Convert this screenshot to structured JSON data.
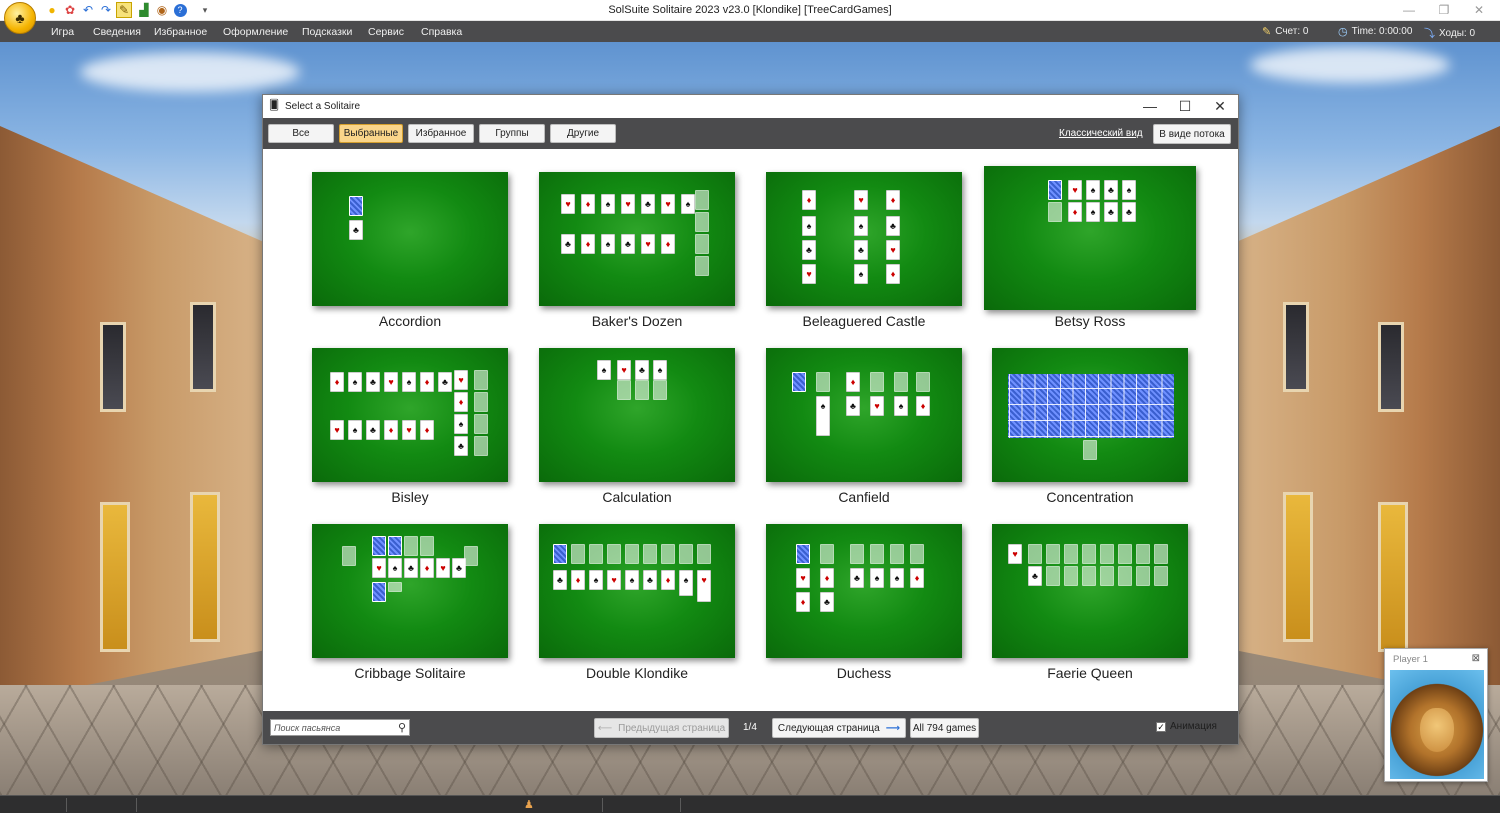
{
  "app": {
    "title": "SolSuite Solitaire 2023 v23.0  [Klondike]  [TreeCardGames]"
  },
  "menu": {
    "items": [
      "Игра",
      "Сведения",
      "Избранное",
      "Оформление",
      "Подсказки",
      "Сервис",
      "Справка"
    ],
    "score_label": "Счет: 0",
    "time_label": "Time: 0:00:00",
    "moves_label": "Ходы: 0"
  },
  "dialog": {
    "title": "Select a Solitaire",
    "tabs": [
      "Все",
      "Выбранные",
      "Избранное",
      "Группы",
      "Другие"
    ],
    "active_tab": "Выбранные",
    "classic_view_link": "Классический вид",
    "flow_view_button": "В виде потока",
    "games": [
      "Accordion",
      "Baker's Dozen",
      "Beleaguered Castle",
      "Betsy Ross",
      "Bisley",
      "Calculation",
      "Canfield",
      "Concentration",
      "Cribbage Solitaire",
      "Double Klondike",
      "Duchess",
      "Faerie Queen"
    ],
    "search_placeholder": "Поиск пасьянса",
    "prev_page": "Предыдущая страница",
    "page_indicator": "1/4",
    "next_page": "Следующая страница",
    "all_games": "All 794 games",
    "animation_label": "Анимация",
    "animation_checked": true
  },
  "player": {
    "name": "Player 1"
  },
  "colors": {
    "menubar": "#4b4b4d",
    "active_tab": "#fad58a",
    "felt": "#128a12"
  }
}
